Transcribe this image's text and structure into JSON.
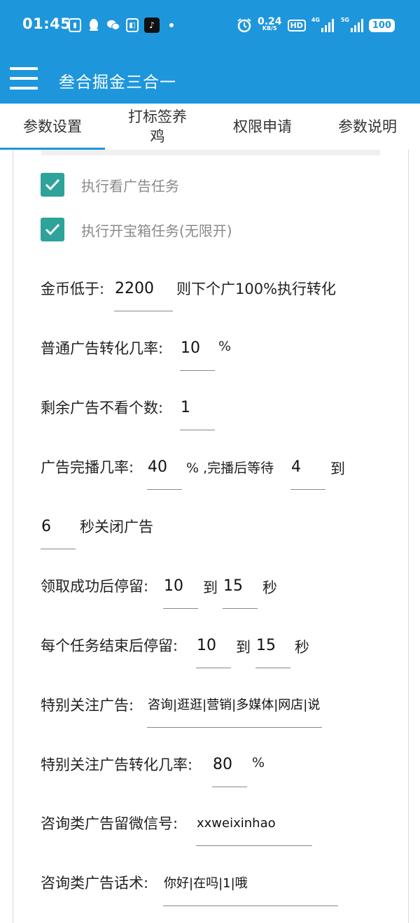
{
  "status_bar": {
    "time": "01:45",
    "speed_value": "0.24",
    "speed_unit": "KB/S",
    "hd": "HD",
    "net1": "4G",
    "net2": "5G",
    "battery": "100"
  },
  "app_bar": {
    "title": "叁合掘金三合一"
  },
  "tabs": [
    {
      "label": "参数设置"
    },
    {
      "label": "打标签养\n鸡"
    },
    {
      "label": "权限申请"
    },
    {
      "label": "参数说明"
    }
  ],
  "checkboxes": [
    {
      "label": "执行看广告任务"
    },
    {
      "label": "执行开宝箱任务(无限开)"
    }
  ],
  "settings": {
    "coin": {
      "label": "金币低于:",
      "value": "2200",
      "suffix": "则下个广100%执行转化"
    },
    "normal_rate": {
      "label": "普通广告转化几率:",
      "value": "10",
      "suffix": "%"
    },
    "remaining": {
      "label": "剩余广告不看个数:",
      "value": "1"
    },
    "complete": {
      "label": "广告完播几率:",
      "value": "40",
      "mid": "% ,完播后等待",
      "wait_from": "4",
      "to": "到",
      "wait_to": "6",
      "suffix": "秒关闭广告"
    },
    "receive_stay": {
      "label": "领取成功后停留:",
      "from": "10",
      "to": "到",
      "to_value": "15",
      "unit": "秒"
    },
    "task_stay": {
      "label": "每个任务结束后停留:",
      "from": "10",
      "to": "到",
      "to_value": "15",
      "unit": "秒"
    },
    "special": {
      "label": "特别关注广告:",
      "value": "咨询|逛逛|营销|多媒体|网店|说"
    },
    "special_rate": {
      "label": "特别关注广告转化几率:",
      "value": "80",
      "suffix": "%"
    },
    "wechat": {
      "label": "咨询类广告留微信号:",
      "value": "xxweixinhao"
    },
    "script": {
      "label": "咨询类广告话术:",
      "value": "你好|在吗|1|哦"
    }
  },
  "colors": {
    "primary": "#1E96DC",
    "checkbox": "#2EA39A"
  }
}
